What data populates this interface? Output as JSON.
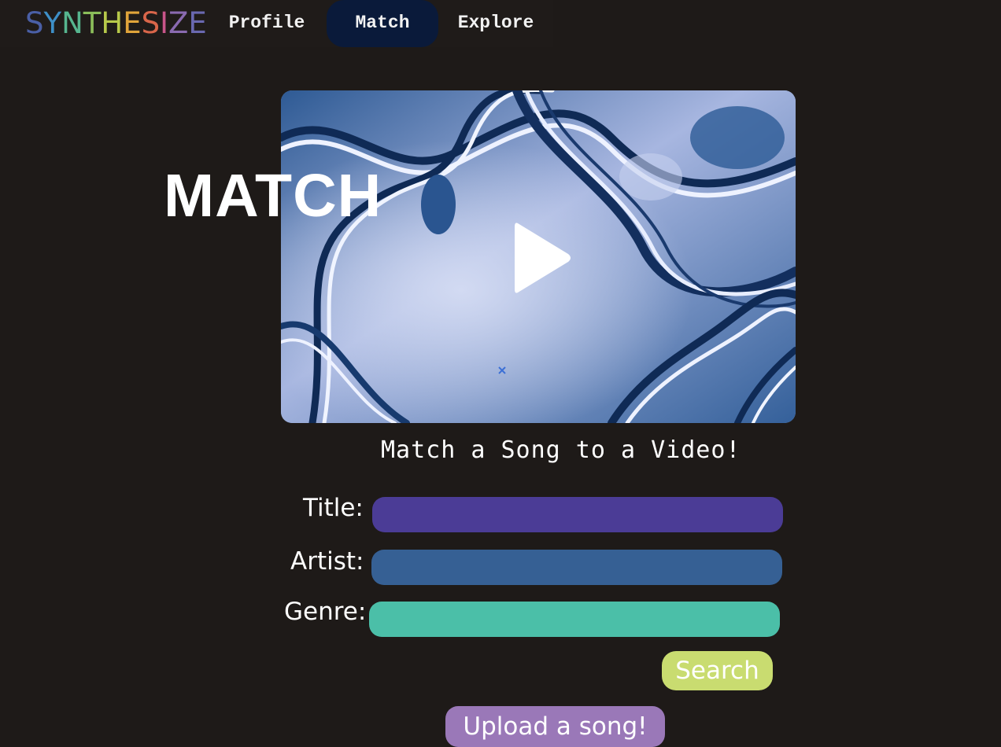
{
  "brand": {
    "letters": [
      "S",
      "Y",
      "N",
      "T",
      "H",
      "E",
      "S",
      "I",
      "Z",
      "E"
    ],
    "letter_colors": [
      "#4a5fa6",
      "#3e8fc7",
      "#56b58f",
      "#8bbe5a",
      "#b7c94a",
      "#e0a43a",
      "#d9664a",
      "#c9558a",
      "#8a6ab0",
      "#6a68b0"
    ]
  },
  "nav": {
    "profile": "Profile",
    "match": "Match",
    "explore": "Explore",
    "active_bg": "#0a1a3a"
  },
  "hero": {
    "heading": "MATCH",
    "close_glyph": "×",
    "play_icon": "play-icon"
  },
  "subtitle": "Match a Song to a Video!",
  "form": {
    "title_label": "Title:",
    "artist_label": "Artist:",
    "genre_label": "Genre:",
    "title_value": "",
    "artist_value": "",
    "genre_value": "",
    "colors": {
      "title": "#4b3c96",
      "artist": "#366094",
      "genre": "#4bbfa8"
    }
  },
  "actions": {
    "search": "Search",
    "upload": "Upload a song!",
    "search_color": "#c9dc70",
    "upload_color": "#9a78b8"
  },
  "colors": {
    "background": "#1e1a18"
  }
}
